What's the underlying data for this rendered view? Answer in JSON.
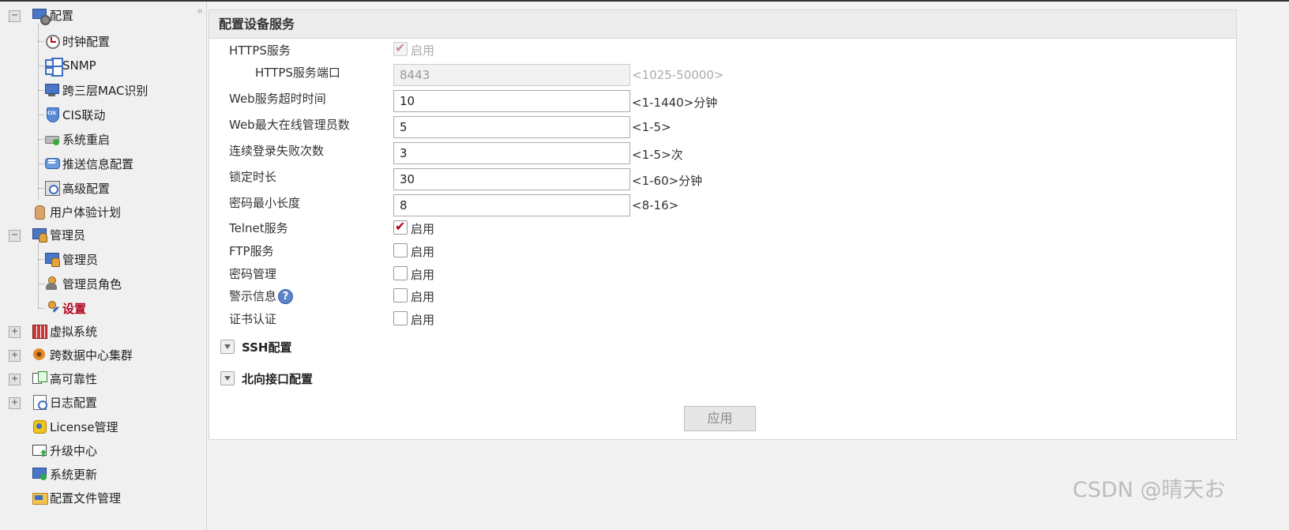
{
  "sidebar": {
    "collapse_symbol": "«",
    "items": [
      {
        "label": "配置",
        "icon": "config-monitor-icon",
        "toggle": "−"
      },
      {
        "label": "时钟配置",
        "icon": "clock-icon"
      },
      {
        "label": "SNMP",
        "icon": "snmp-icon"
      },
      {
        "label": "跨三层MAC识别",
        "icon": "monitor-icon"
      },
      {
        "label": "CIS联动",
        "icon": "shield-icon"
      },
      {
        "label": "系统重启",
        "icon": "restart-icon"
      },
      {
        "label": "推送信息配置",
        "icon": "message-icon"
      },
      {
        "label": "高级配置",
        "icon": "advanced-config-icon"
      },
      {
        "label": "用户体验计划",
        "icon": "hand-icon"
      },
      {
        "label": "管理员",
        "icon": "admin-icon",
        "toggle": "−"
      },
      {
        "label": "管理员",
        "icon": "admin-icon"
      },
      {
        "label": "管理员角色",
        "icon": "admin-role-icon"
      },
      {
        "label": "设置",
        "icon": "admin-settings-icon",
        "active": true
      },
      {
        "label": "虚拟系统",
        "icon": "virtual-system-icon",
        "toggle": "+"
      },
      {
        "label": "跨数据中心集群",
        "icon": "cluster-icon",
        "toggle": "+"
      },
      {
        "label": "高可靠性",
        "icon": "high-availability-icon",
        "toggle": "+"
      },
      {
        "label": "日志配置",
        "icon": "log-icon",
        "toggle": "+"
      },
      {
        "label": "License管理",
        "icon": "license-key-icon"
      },
      {
        "label": "升级中心",
        "icon": "upgrade-icon"
      },
      {
        "label": "系统更新",
        "icon": "system-update-icon"
      },
      {
        "label": "配置文件管理",
        "icon": "config-folder-icon"
      }
    ]
  },
  "panel": {
    "title": "配置设备服务",
    "https_service": {
      "label": "HTTPS服务",
      "checkbox_label": "启用",
      "checked": true,
      "disabled": true
    },
    "https_port": {
      "label": "HTTPS服务端口",
      "value": "8443",
      "hint": "<1025-50000>",
      "disabled": true
    },
    "web_timeout": {
      "label": "Web服务超时时间",
      "value": "10",
      "hint": "<1-1440>分钟"
    },
    "web_max_admins": {
      "label": "Web最大在线管理员数",
      "value": "5",
      "hint": "<1-5>"
    },
    "login_fail_count": {
      "label": "连续登录失败次数",
      "value": "3",
      "hint": "<1-5>次"
    },
    "lock_duration": {
      "label": "锁定时长",
      "value": "30",
      "hint": "<1-60>分钟"
    },
    "password_min_length": {
      "label": "密码最小长度",
      "value": "8",
      "hint": "<8-16>"
    },
    "telnet_service": {
      "label": "Telnet服务",
      "checkbox_label": "启用",
      "checked": true
    },
    "ftp_service": {
      "label": "FTP服务",
      "checkbox_label": "启用",
      "checked": false
    },
    "password_management": {
      "label": "密码管理",
      "checkbox_label": "启用",
      "checked": false
    },
    "warning_info": {
      "label": "警示信息",
      "help_symbol": "?",
      "checkbox_label": "启用",
      "checked": false
    },
    "cert_auth": {
      "label": "证书认证",
      "checkbox_label": "启用",
      "checked": false
    },
    "sections": [
      {
        "label": "SSH配置",
        "expanded": false
      },
      {
        "label": "北向接口配置",
        "expanded": false
      }
    ],
    "apply_button": "应用"
  },
  "watermark": "CSDN @晴天お"
}
